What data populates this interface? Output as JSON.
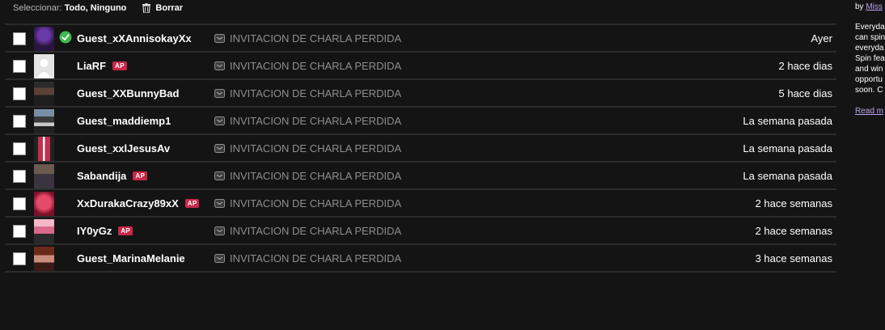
{
  "toolbar": {
    "select_prefix": "Seleccionar:",
    "select_all": "Todo",
    "separator": ",",
    "select_none": "Ninguno",
    "delete_label": "Borrar"
  },
  "messages": [
    {
      "name": "Guest_xXAnnisokayXx",
      "ap": false,
      "verified": true,
      "subject": "INVITACION DE CHARLA PERDIDA",
      "date": "Ayer"
    },
    {
      "name": "LiaRF",
      "ap": true,
      "ap_label": "AP",
      "subject": "INVITACION DE CHARLA PERDIDA",
      "date": "2 hace dias"
    },
    {
      "name": "Guest_XXBunnyBad",
      "ap": false,
      "subject": "INVITACION DE CHARLA PERDIDA",
      "date": "5 hace dias"
    },
    {
      "name": "Guest_maddiemp1",
      "ap": false,
      "subject": "INVITACION DE CHARLA PERDIDA",
      "date": "La semana pasada"
    },
    {
      "name": "Guest_xxlJesusAv",
      "ap": false,
      "subject": "INVITACION DE CHARLA PERDIDA",
      "date": "La semana pasada"
    },
    {
      "name": "Sabandija",
      "ap": true,
      "ap_label": "AP",
      "subject": "INVITACION DE CHARLA PERDIDA",
      "date": "La semana pasada"
    },
    {
      "name": "XxDurakaCrazy89xX",
      "ap": true,
      "ap_label": "AP",
      "subject": "INVITACION DE CHARLA PERDIDA",
      "date": "2 hace semanas"
    },
    {
      "name": "IY0yGz",
      "ap": true,
      "ap_label": "AP",
      "subject": "INVITACION DE CHARLA PERDIDA",
      "date": "2 hace semanas"
    },
    {
      "name": "Guest_MarinaMelanie",
      "ap": false,
      "subject": "INVITACION DE CHARLA PERDIDA",
      "date": "3 hace semanas"
    }
  ],
  "sidebar": {
    "by_prefix": "by",
    "author": "Miss",
    "description_lines": [
      "Everyda",
      "can spin",
      "everyda",
      "Spin fea",
      "and win",
      "opportu",
      "soon. C"
    ],
    "read_more": "Read m"
  },
  "colors": {
    "background": "#151415",
    "row_divider": "#2d2c2d",
    "ap_badge": "#c8284a",
    "verified": "#3fb950",
    "subject_text": "#8e8e8e",
    "link": "#b9a6ee"
  },
  "icons": {
    "delete": "trash-icon",
    "verified": "check-circle-icon",
    "subject": "message-icon"
  }
}
